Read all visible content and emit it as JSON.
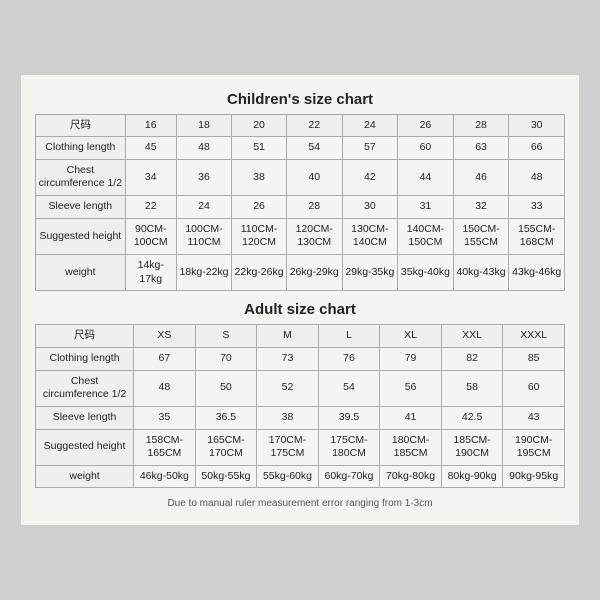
{
  "children_chart": {
    "title": "Children's size chart",
    "columns": [
      "尺码",
      "16",
      "18",
      "20",
      "22",
      "24",
      "26",
      "28",
      "30"
    ],
    "rows": [
      {
        "label": "Clothing length",
        "values": [
          "45",
          "48",
          "51",
          "54",
          "57",
          "60",
          "63",
          "66"
        ]
      },
      {
        "label": "Chest circumference 1/2",
        "values": [
          "34",
          "36",
          "38",
          "40",
          "42",
          "44",
          "46",
          "48"
        ]
      },
      {
        "label": "Sleeve length",
        "values": [
          "22",
          "24",
          "26",
          "28",
          "30",
          "31",
          "32",
          "33"
        ]
      },
      {
        "label": "Suggested height",
        "values": [
          "90CM-100CM",
          "100CM-110CM",
          "110CM-120CM",
          "120CM-130CM",
          "130CM-140CM",
          "140CM-150CM",
          "150CM-155CM",
          "155CM-168CM"
        ]
      },
      {
        "label": "weight",
        "values": [
          "14kg-17kg",
          "18kg-22kg",
          "22kg-26kg",
          "26kg-29kg",
          "29kg-35kg",
          "35kg-40kg",
          "40kg-43kg",
          "43kg-46kg"
        ]
      }
    ]
  },
  "adult_chart": {
    "title": "Adult size chart",
    "columns": [
      "尺码",
      "XS",
      "S",
      "M",
      "L",
      "XL",
      "XXL",
      "XXXL"
    ],
    "rows": [
      {
        "label": "Clothing length",
        "values": [
          "67",
          "70",
          "73",
          "76",
          "79",
          "82",
          "85"
        ]
      },
      {
        "label": "Chest circumference 1/2",
        "values": [
          "48",
          "50",
          "52",
          "54",
          "56",
          "58",
          "60"
        ]
      },
      {
        "label": "Sleeve length",
        "values": [
          "35",
          "36.5",
          "38",
          "39.5",
          "41",
          "42.5",
          "43"
        ]
      },
      {
        "label": "Suggested height",
        "values": [
          "158CM-165CM",
          "165CM-170CM",
          "170CM-175CM",
          "175CM-180CM",
          "180CM-185CM",
          "185CM-190CM",
          "190CM-195CM"
        ]
      },
      {
        "label": "weight",
        "values": [
          "46kg-50kg",
          "50kg-55kg",
          "55kg-60kg",
          "60kg-70kg",
          "70kg-80kg",
          "80kg-90kg",
          "90kg-95kg"
        ]
      }
    ]
  },
  "note": "Due to manual ruler measurement error ranging from 1-3cm"
}
